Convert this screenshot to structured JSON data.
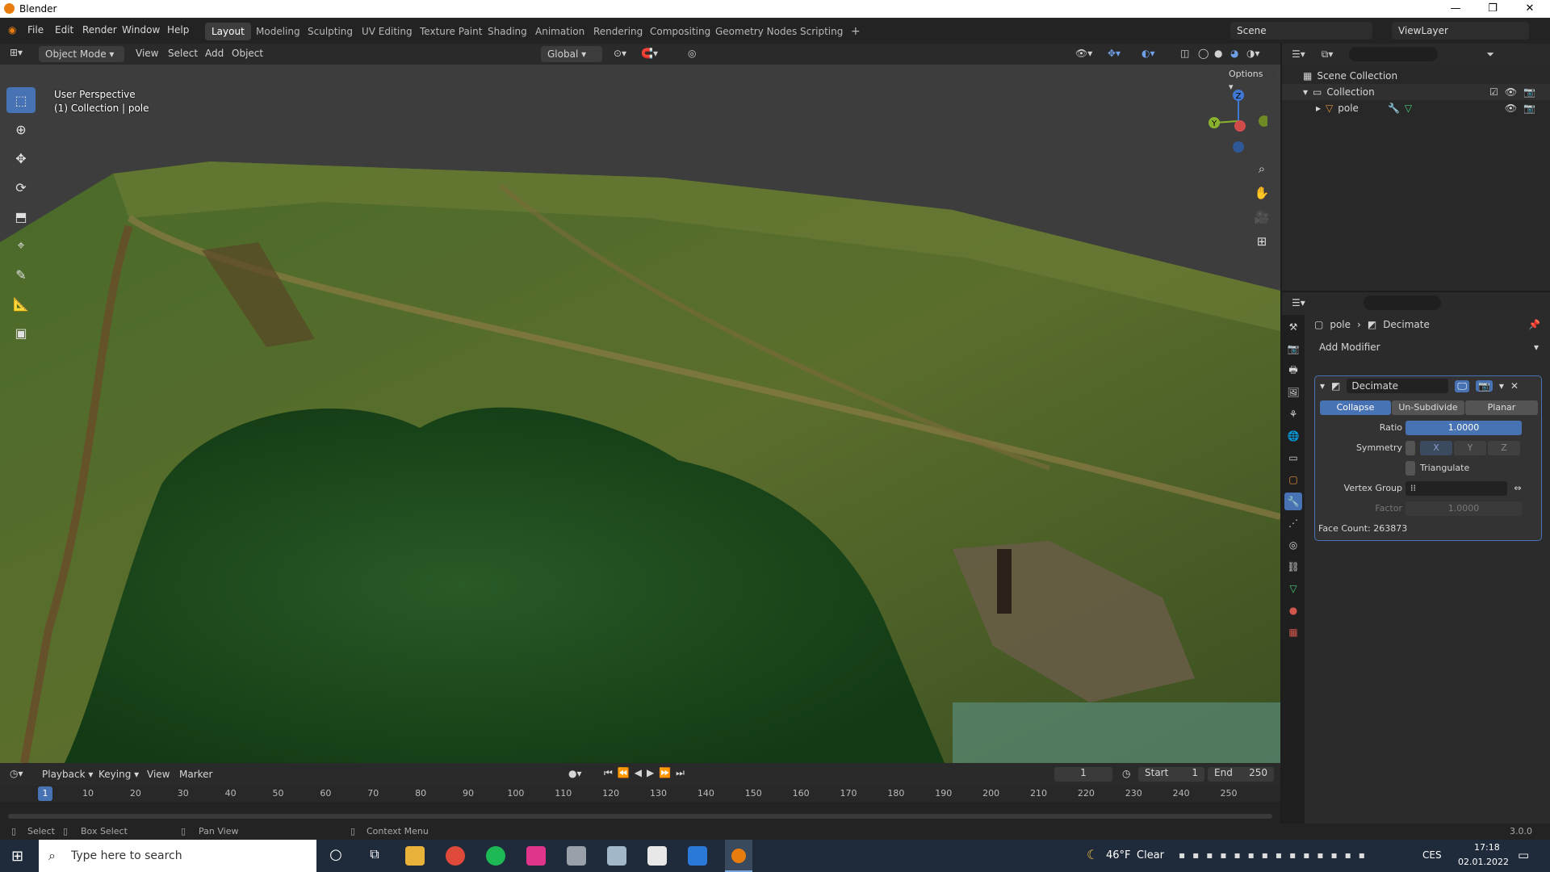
{
  "window": {
    "title": "Blender"
  },
  "menus": [
    "File",
    "Edit",
    "Render",
    "Window",
    "Help"
  ],
  "workspaces": [
    "Layout",
    "Modeling",
    "Sculpting",
    "UV Editing",
    "Texture Paint",
    "Shading",
    "Animation",
    "Rendering",
    "Compositing",
    "Geometry Nodes",
    "Scripting"
  ],
  "active_workspace": "Layout",
  "add_tab": "+",
  "scene": {
    "name": "Scene",
    "view_layer": "ViewLayer"
  },
  "viewport": {
    "mode": "Object Mode",
    "header_menus": [
      "View",
      "Select",
      "Add",
      "Object"
    ],
    "transform_orientation": "Global",
    "options_label": "Options",
    "perspective": "User Perspective",
    "collection_info": "(1) Collection | pole",
    "gizmo_axes": {
      "z": "Z",
      "y": "Y"
    },
    "colors": {
      "x_axis": "#d14b4b",
      "y_axis": "#8ab22f",
      "z_axis": "#3f79d4"
    }
  },
  "outliner": {
    "scene_collection": "Scene Collection",
    "collection": "Collection",
    "object": "pole"
  },
  "properties": {
    "breadcrumb_object": "pole",
    "breadcrumb_modifier": "Decimate",
    "add_modifier": "Add Modifier",
    "modifier": {
      "name": "Decimate",
      "modes": [
        "Collapse",
        "Un-Subdivide",
        "Planar"
      ],
      "active_mode": "Collapse",
      "ratio_label": "Ratio",
      "ratio": "1.0000",
      "symmetry_label": "Symmetry",
      "symmetry_axes": [
        "X",
        "Y",
        "Z"
      ],
      "triangulate_label": "Triangulate",
      "vertex_group_label": "Vertex Group",
      "factor_label": "Factor",
      "factor": "1.0000",
      "face_count": "Face Count: 263873"
    },
    "accent": "#4772b3"
  },
  "timeline": {
    "menus": [
      "Playback",
      "Keying",
      "View",
      "Marker"
    ],
    "current_frame": "1",
    "start_label": "Start",
    "start": "1",
    "end_label": "End",
    "end": "250",
    "ticks": [
      "1",
      "10",
      "20",
      "30",
      "40",
      "50",
      "60",
      "70",
      "80",
      "90",
      "100",
      "110",
      "120",
      "130",
      "140",
      "150",
      "160",
      "170",
      "180",
      "190",
      "200",
      "210",
      "220",
      "230",
      "240",
      "250"
    ]
  },
  "statusbar": {
    "select": "Select",
    "box_select": "Box Select",
    "pan_view": "Pan View",
    "context_menu": "Context Menu",
    "version": "3.0.0"
  },
  "taskbar": {
    "search_placeholder": "Type here to search",
    "weather_temp": "46°F",
    "weather_text": "Clear",
    "language": "CES",
    "time": "17:18",
    "date": "02.01.2022"
  }
}
